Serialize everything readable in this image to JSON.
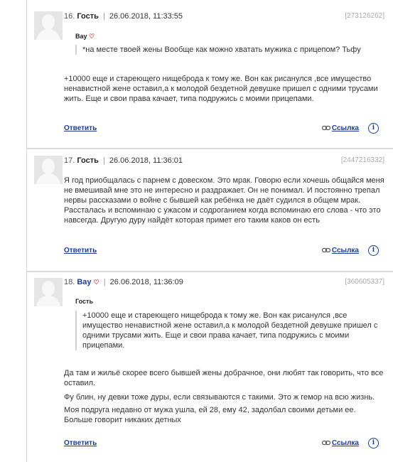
{
  "comments": [
    {
      "num": "16.",
      "user": "Гость",
      "user_is_link": false,
      "datetime": "26.06.2018, 11:33:55",
      "id": "[273126262]",
      "quote_author": "Вау",
      "quote_author_heart": true,
      "quote_text": "*на месте твоей жены Вообще как можно хватать мужика с прицепом? Тьфу",
      "body": [
        "+10000 еще и стареющего нищеброда к тому же. Вон как рисанулся ,все имущество ненавистной жене оставил,а к молодой бездетной девушке пришел с одними трусами жить. Еще и свои права качает, типа подружись с моими прицепами."
      ],
      "reply_label": "Ответить",
      "link_label": "Ссылка",
      "info_label": "i"
    },
    {
      "num": "17.",
      "user": "Гость",
      "user_is_link": false,
      "datetime": "26.06.2018, 11:36:01",
      "id": "[2447216332]",
      "quote_author": "",
      "quote_text": "",
      "body": [
        "Я год приобщалась с парнем с довеском. Это мрак. Говорю если хочешь общайся меня не вмешивай мне это не интересно и раздражает. Он не понимал. И постоянно трепал нервы рассказами о войне с бывшей как ребёнка не даёт судился в общем мрак. Рассталась и вспоминаю с ужасом и содроганием когда вспоминаю его слова - что это навсегда. Другую дуру найдёт которая примет его таким каков он есть"
      ],
      "reply_label": "Ответить",
      "link_label": "Ссылка",
      "info_label": "i"
    },
    {
      "num": "18.",
      "user": "Вау",
      "user_is_link": true,
      "user_heart": true,
      "datetime": "26.06.2018, 11:36:09",
      "id": "[360605337]",
      "quote_author": "Гость",
      "quote_author_heart": false,
      "quote_text": "+10000 еще и стареющего нищеброда к тому же. Вон как рисанулся ,все имущество ненавистной жене оставил,а к молодой бездетной девушке пришел с одними трусами жить. Еще и свои права качает, типа подружись с моими прицепами.",
      "body": [
        "Да там и жильё скорее всего бывшей жены добрачное, они любят так говорить, что все оставил.",
        "Фу блин, ну девки тоже дуры, если связываются с такими. Это ж гемор на всю жизнь.",
        "Моя подруга недавно от мужа ушла, ей 28, ему 42, задолбал своими детьми ее. Больше говорит никаких детных"
      ],
      "reply_label": "Ответить",
      "link_label": "Ссылка",
      "info_label": "i"
    }
  ]
}
